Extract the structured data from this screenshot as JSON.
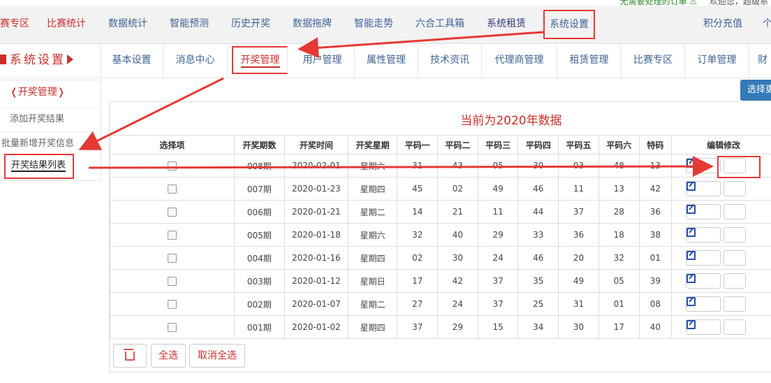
{
  "top": {
    "warning": "无需要处理的订单 ⚠",
    "welcome": "欢迎您，超级系"
  },
  "main_nav": {
    "items": [
      "赛专区",
      "比赛统计",
      "数据统计",
      "智能预测",
      "历史开奖",
      "数据拖牌",
      "智能走势",
      "六合工具箱",
      "系统租赁",
      "系统设置"
    ],
    "right": [
      "积分充值",
      "个"
    ]
  },
  "sub_nav": {
    "section_title": "系统设置",
    "tabs": [
      "基本设置",
      "消息中心",
      "开奖管理",
      "用户管理",
      "属性管理",
      "技术资讯",
      "代理商管理",
      "租赁管理",
      "比赛专区",
      "订单管理",
      "财"
    ]
  },
  "sidebar": {
    "header": "开奖管理",
    "items": [
      "添加开奖结果",
      "批量新增开奖信息",
      "开奖结果列表"
    ]
  },
  "choose_button": "选择更",
  "table": {
    "caption": "当前为2020年数据",
    "headers": [
      "选择项",
      "开奖期数",
      "开奖时间",
      "开奖星期",
      "平码一",
      "平码二",
      "平码三",
      "平码四",
      "平码五",
      "平码六",
      "特码",
      "编辑修改"
    ],
    "rows": [
      [
        "008期",
        "2020-02-01",
        "星期六",
        "31",
        "43",
        "05",
        "30",
        "03",
        "48",
        "13"
      ],
      [
        "007期",
        "2020-01-23",
        "星期四",
        "45",
        "02",
        "49",
        "46",
        "11",
        "13",
        "42"
      ],
      [
        "006期",
        "2020-01-21",
        "星期二",
        "14",
        "21",
        "11",
        "44",
        "37",
        "28",
        "36"
      ],
      [
        "005期",
        "2020-01-18",
        "星期六",
        "32",
        "40",
        "29",
        "33",
        "36",
        "18",
        "38"
      ],
      [
        "004期",
        "2020-01-16",
        "星期四",
        "02",
        "30",
        "24",
        "46",
        "20",
        "32",
        "01"
      ],
      [
        "003期",
        "2020-01-12",
        "星期日",
        "17",
        "42",
        "37",
        "35",
        "49",
        "05",
        "39"
      ],
      [
        "002期",
        "2020-01-07",
        "星期二",
        "27",
        "24",
        "37",
        "25",
        "31",
        "01",
        "08"
      ],
      [
        "001期",
        "2020-01-02",
        "星期四",
        "37",
        "29",
        "15",
        "34",
        "30",
        "17",
        "40"
      ]
    ]
  },
  "buttons": {
    "select_all": "全选",
    "cancel_select": "取消全选"
  },
  "icons": {
    "delete": "trash-icon",
    "edit": "edit-icon"
  },
  "colors": {
    "accent_red": "#c9302c",
    "link_blue": "#3f6496",
    "annotation_red": "#e53935",
    "primary_blue": "#337ab7"
  }
}
